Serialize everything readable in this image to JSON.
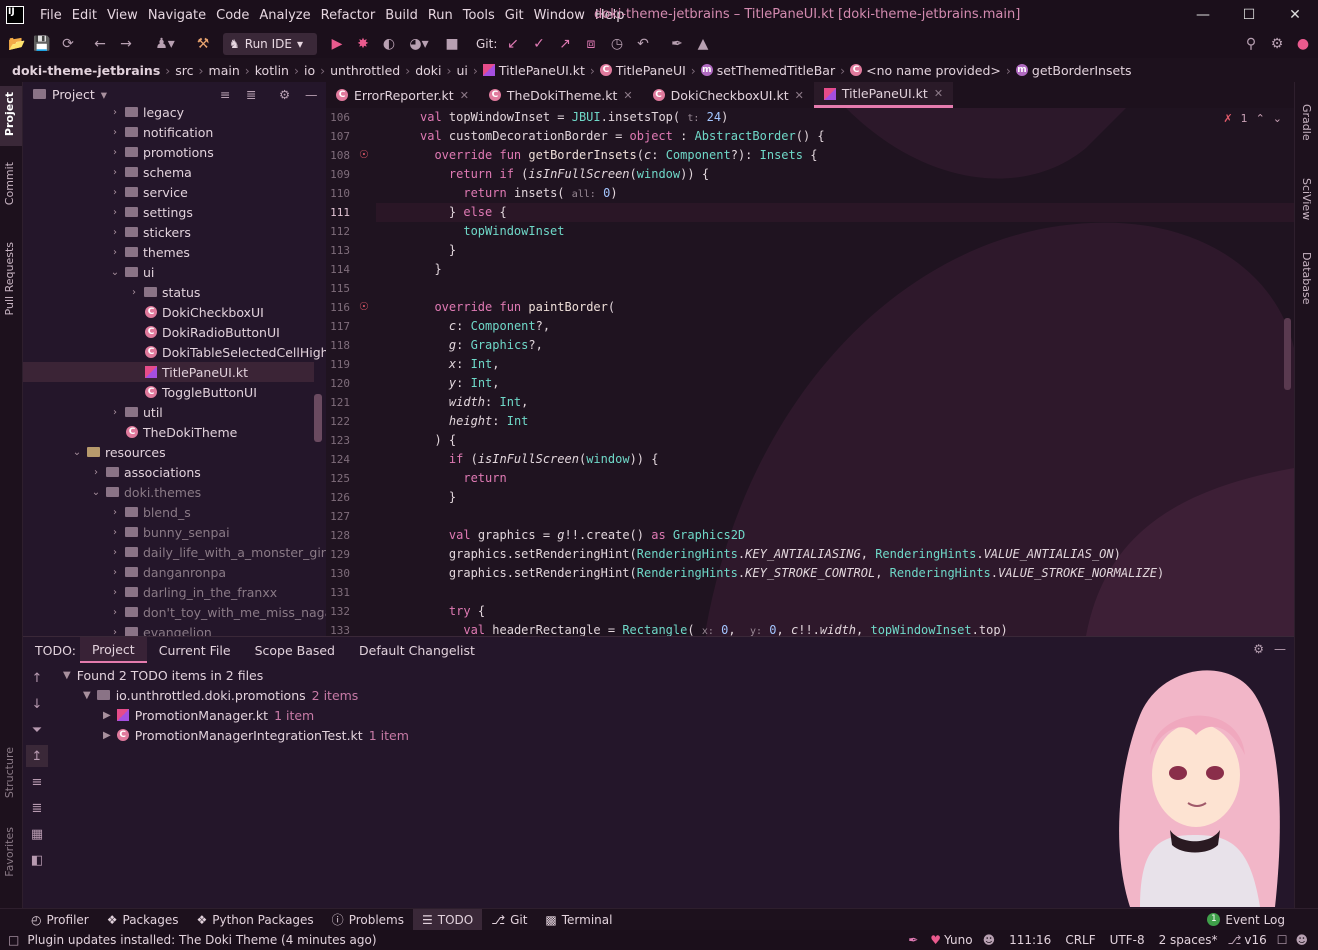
{
  "window": {
    "title": "doki-theme-jetbrains – TitlePaneUI.kt [doki-theme-jetbrains.main]",
    "logo": "IJ"
  },
  "menu": [
    "File",
    "Edit",
    "View",
    "Navigate",
    "Code",
    "Analyze",
    "Refactor",
    "Build",
    "Run",
    "Tools",
    "Git",
    "Window",
    "Help"
  ],
  "toolbar": {
    "run_config": "Run IDE",
    "git_label": "Git:"
  },
  "breadcrumb": [
    "doki-theme-jetbrains",
    "src",
    "main",
    "kotlin",
    "io",
    "unthrottled",
    "doki",
    "ui",
    "TitlePaneUI.kt",
    "TitlePaneUI",
    "setThemedTitleBar",
    "<no name provided>",
    "getBorderInsets"
  ],
  "left_strip": {
    "project": "Project",
    "commit": "Commit",
    "pull_requests": "Pull Requests",
    "structure": "Structure",
    "favorites": "Favorites"
  },
  "right_strip": {
    "gradle": "Gradle",
    "sciview": "SciView",
    "database": "Database"
  },
  "project_panel": {
    "title": "Project",
    "tree": [
      {
        "label": "legacy",
        "type": "folder"
      },
      {
        "label": "notification",
        "type": "folder"
      },
      {
        "label": "promotions",
        "type": "folder"
      },
      {
        "label": "schema",
        "type": "folder"
      },
      {
        "label": "service",
        "type": "folder"
      },
      {
        "label": "settings",
        "type": "folder"
      },
      {
        "label": "stickers",
        "type": "folder"
      },
      {
        "label": "themes",
        "type": "folder"
      },
      {
        "label": "ui",
        "type": "folder"
      },
      {
        "label": "status",
        "type": "folder"
      },
      {
        "label": "DokiCheckboxUI",
        "type": "class"
      },
      {
        "label": "DokiRadioButtonUI",
        "type": "class"
      },
      {
        "label": "DokiTableSelectedCellHighl",
        "type": "class"
      },
      {
        "label": "TitlePaneUI.kt",
        "type": "kt"
      },
      {
        "label": "ToggleButtonUI",
        "type": "class"
      },
      {
        "label": "util",
        "type": "folder"
      },
      {
        "label": "TheDokiTheme",
        "type": "class"
      },
      {
        "label": "resources",
        "type": "folder"
      },
      {
        "label": "associations",
        "type": "folder"
      },
      {
        "label": "doki.themes",
        "type": "folder"
      },
      {
        "label": "blend_s",
        "type": "folder"
      },
      {
        "label": "bunny_senpai",
        "type": "folder"
      },
      {
        "label": "daily_life_with_a_monster_girl",
        "type": "folder"
      },
      {
        "label": "danganronpa",
        "type": "folder"
      },
      {
        "label": "darling_in_the_franxx",
        "type": "folder"
      },
      {
        "label": "don't_toy_with_me_miss_nagat",
        "type": "folder"
      },
      {
        "label": "evangelion",
        "type": "folder"
      }
    ]
  },
  "editor": {
    "tabs": [
      "ErrorReporter.kt",
      "TheDokiTheme.kt",
      "DokiCheckboxUI.kt",
      "TitlePaneUI.kt"
    ],
    "active_tab": "TitlePaneUI.kt",
    "inspection_count": "1",
    "current_line": "111",
    "line_numbers": [
      "106",
      "107",
      "108",
      "109",
      "110",
      "111",
      "112",
      "113",
      "114",
      "115",
      "116",
      "117",
      "118",
      "119",
      "120",
      "121",
      "122",
      "123",
      "124",
      "125",
      "126",
      "127",
      "128",
      "129",
      "130",
      "131",
      "132",
      "133"
    ]
  },
  "todo": {
    "label": "TODO:",
    "tabs": [
      "Project",
      "Current File",
      "Scope Based",
      "Default Changelist"
    ],
    "summary": "Found 2 TODO items in 2 files",
    "package": "io.unthrottled.doki.promotions",
    "package_count": "2 items",
    "files": [
      {
        "name": "PromotionManager.kt",
        "count": "1 item"
      },
      {
        "name": "PromotionManagerIntegrationTest.kt",
        "count": "1 item"
      }
    ]
  },
  "bottom_tools": [
    "Profiler",
    "Packages",
    "Python Packages",
    "Problems",
    "TODO",
    "Git",
    "Terminal"
  ],
  "event_log": {
    "label": "Event Log",
    "count": "1"
  },
  "status": {
    "message": "Plugin updates installed: The Doki Theme (4 minutes ago)",
    "theme": "Yuno",
    "position": "111:16",
    "line_sep": "CRLF",
    "encoding": "UTF-8",
    "indent": "2 spaces*",
    "vcs": "v16"
  }
}
